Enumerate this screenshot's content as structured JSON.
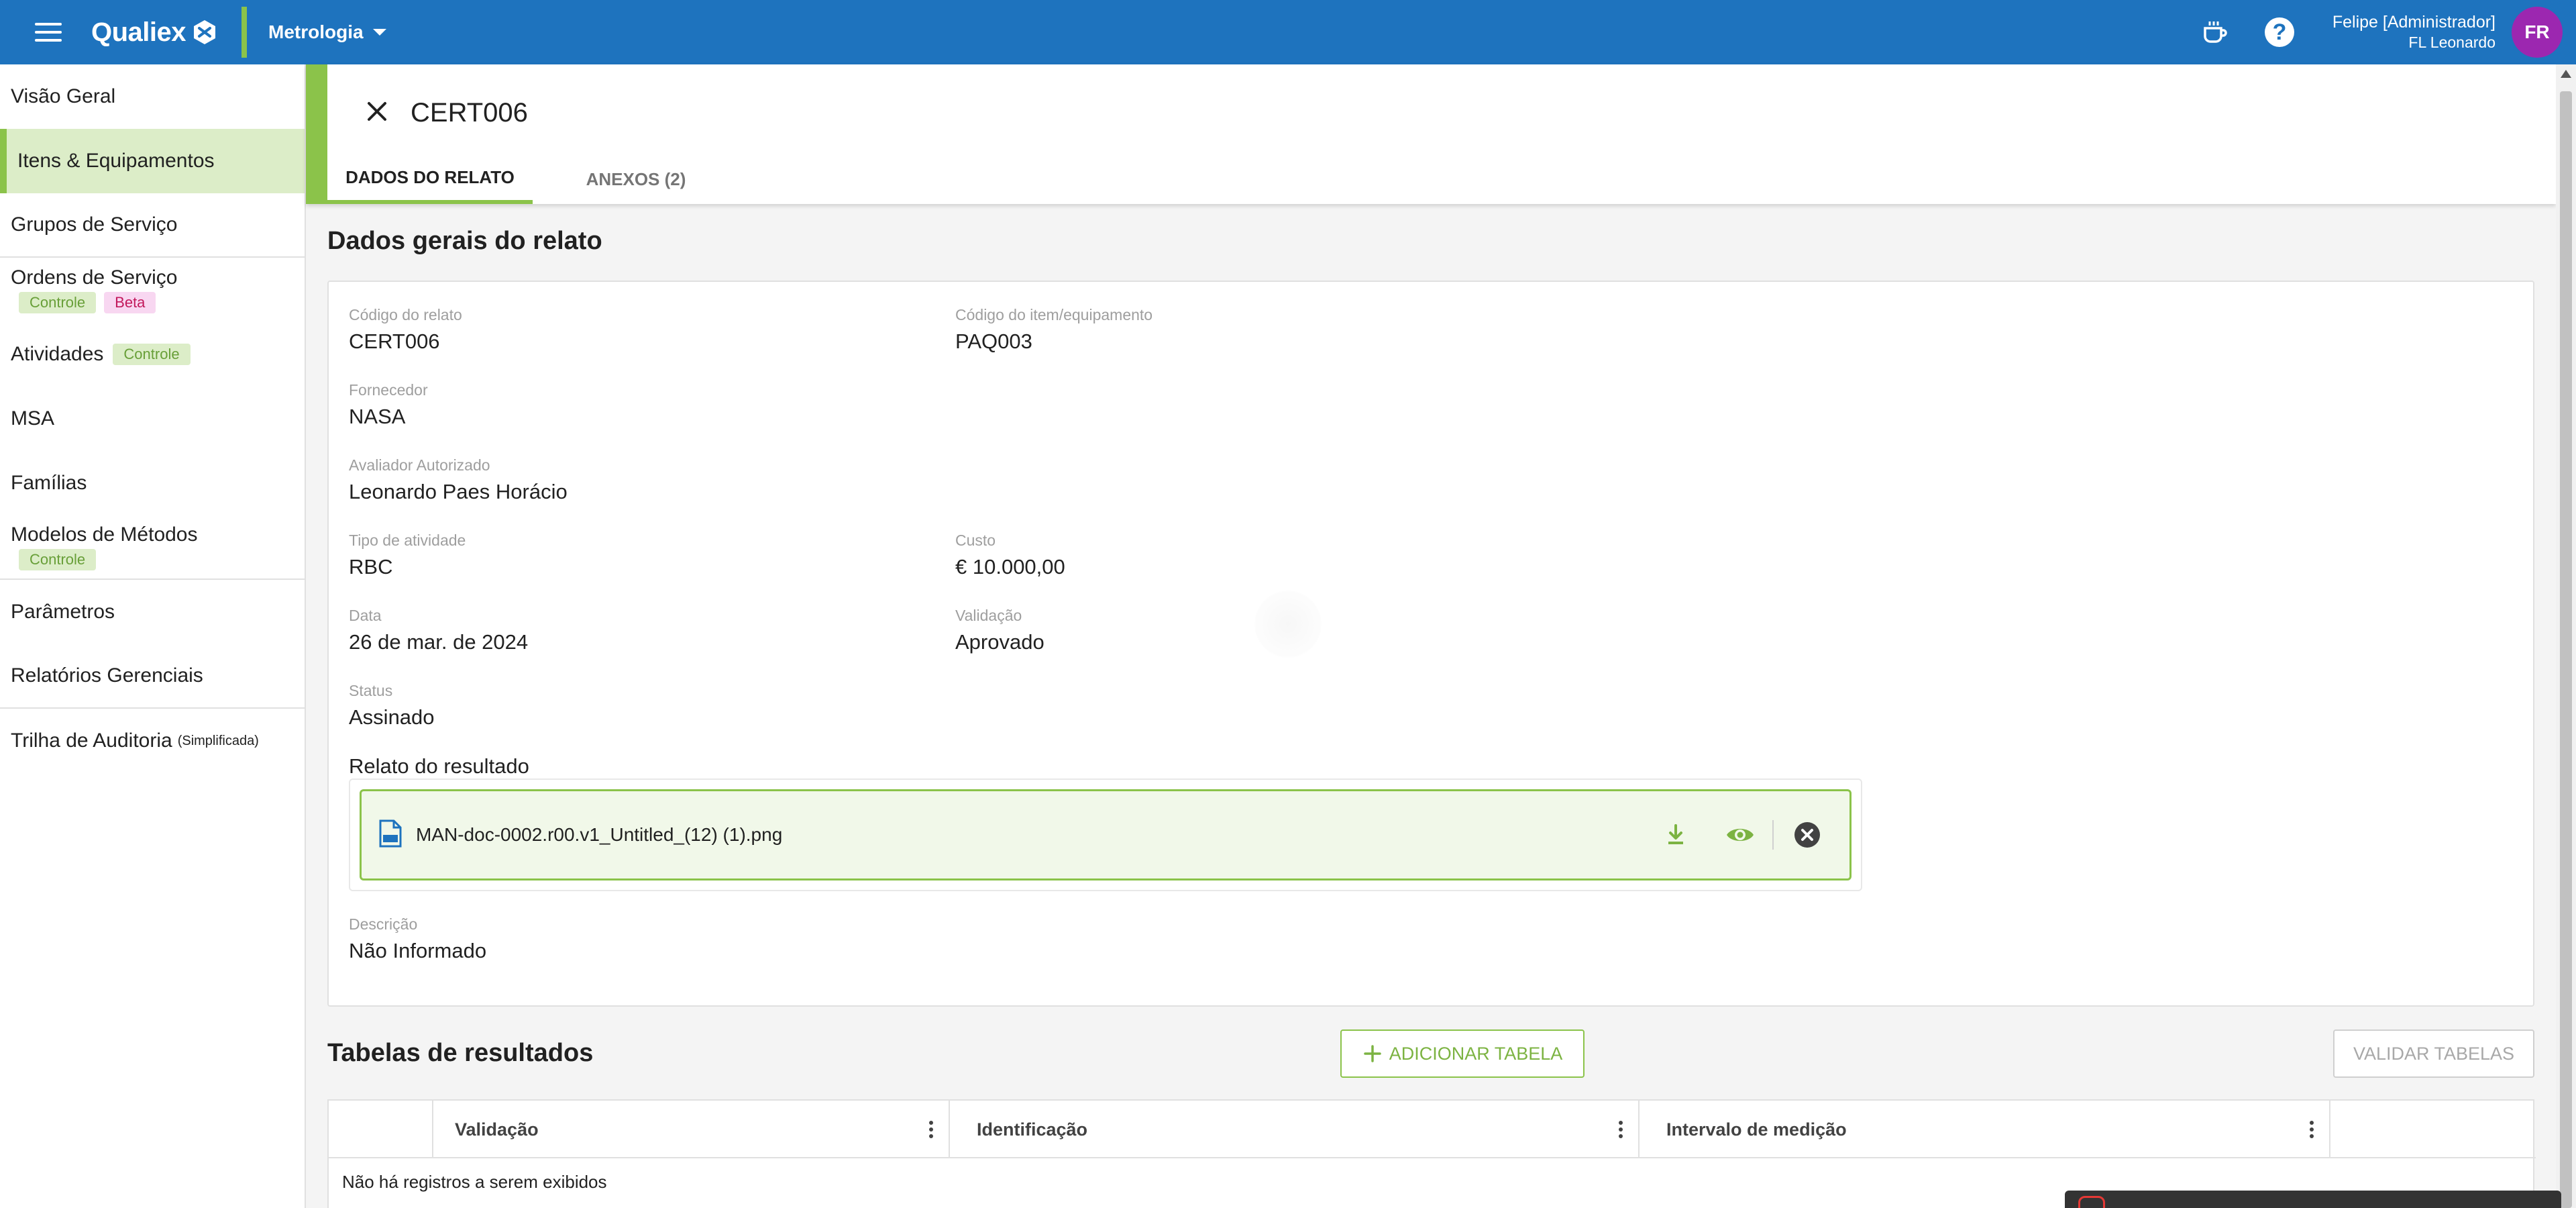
{
  "app": {
    "brand": "Qualiex",
    "module": "Metrologia",
    "user_name": "Felipe [Administrador]",
    "user_sub": "FL Leonardo",
    "avatar_initials": "FR",
    "brand_color": "#1e73be",
    "accent_color": "#8bc34a"
  },
  "sidebar": {
    "items": [
      {
        "label": "Visão Geral"
      },
      {
        "label": "Itens & Equipamentos",
        "active": true
      },
      {
        "label": "Grupos de Serviço"
      },
      {
        "label": "Ordens de Serviço",
        "badges": [
          "Controle",
          "Beta"
        ]
      },
      {
        "label": "Atividades",
        "badges": [
          "Controle"
        ]
      },
      {
        "label": "MSA"
      },
      {
        "label": "Famílias"
      },
      {
        "label": "Modelos de Métodos",
        "badges": [
          "Controle"
        ]
      },
      {
        "label": "Parâmetros"
      },
      {
        "label": "Relatórios Gerenciais"
      },
      {
        "label": "Trilha de Auditoria",
        "note": "(Simplificada)"
      }
    ]
  },
  "header": {
    "title": "CERT006",
    "tabs": [
      {
        "label": "DADOS DO RELATO",
        "active": true
      },
      {
        "label": "ANEXOS (2)"
      }
    ]
  },
  "general": {
    "section_title": "Dados gerais do relato",
    "fields": {
      "codigo_relato": {
        "label": "Código do relato",
        "value": "CERT006"
      },
      "codigo_item": {
        "label": "Código do item/equipamento",
        "value": "PAQ003"
      },
      "fornecedor": {
        "label": "Fornecedor",
        "value": "NASA"
      },
      "avaliador": {
        "label": "Avaliador Autorizado",
        "value": "Leonardo Paes Horácio"
      },
      "tipo_atividade": {
        "label": "Tipo de atividade",
        "value": "RBC"
      },
      "custo": {
        "label": "Custo",
        "value": "€ 10.000,00"
      },
      "data": {
        "label": "Data",
        "value": "26 de mar. de 2024"
      },
      "validacao": {
        "label": "Validação",
        "value": "Aprovado"
      },
      "status": {
        "label": "Status",
        "value": "Assinado"
      },
      "descricao": {
        "label": "Descrição",
        "value": "Não Informado"
      }
    },
    "relato_label": "Relato do resultado",
    "file_name": "MAN-doc-0002.r00.v1_Untitled_(12) (1).png",
    "file_icon": "png-file-icon",
    "file_actions": [
      "download-icon",
      "eye-icon",
      "remove-circle-icon"
    ]
  },
  "tables": {
    "section_title": "Tabelas de resultados",
    "add_button": "ADICIONAR TABELA",
    "validate_button": "VALIDAR TABELAS",
    "columns": [
      "Validação",
      "Identificação",
      "Intervalo de medição"
    ],
    "empty_message": "Não há registros a serem exibidos"
  }
}
